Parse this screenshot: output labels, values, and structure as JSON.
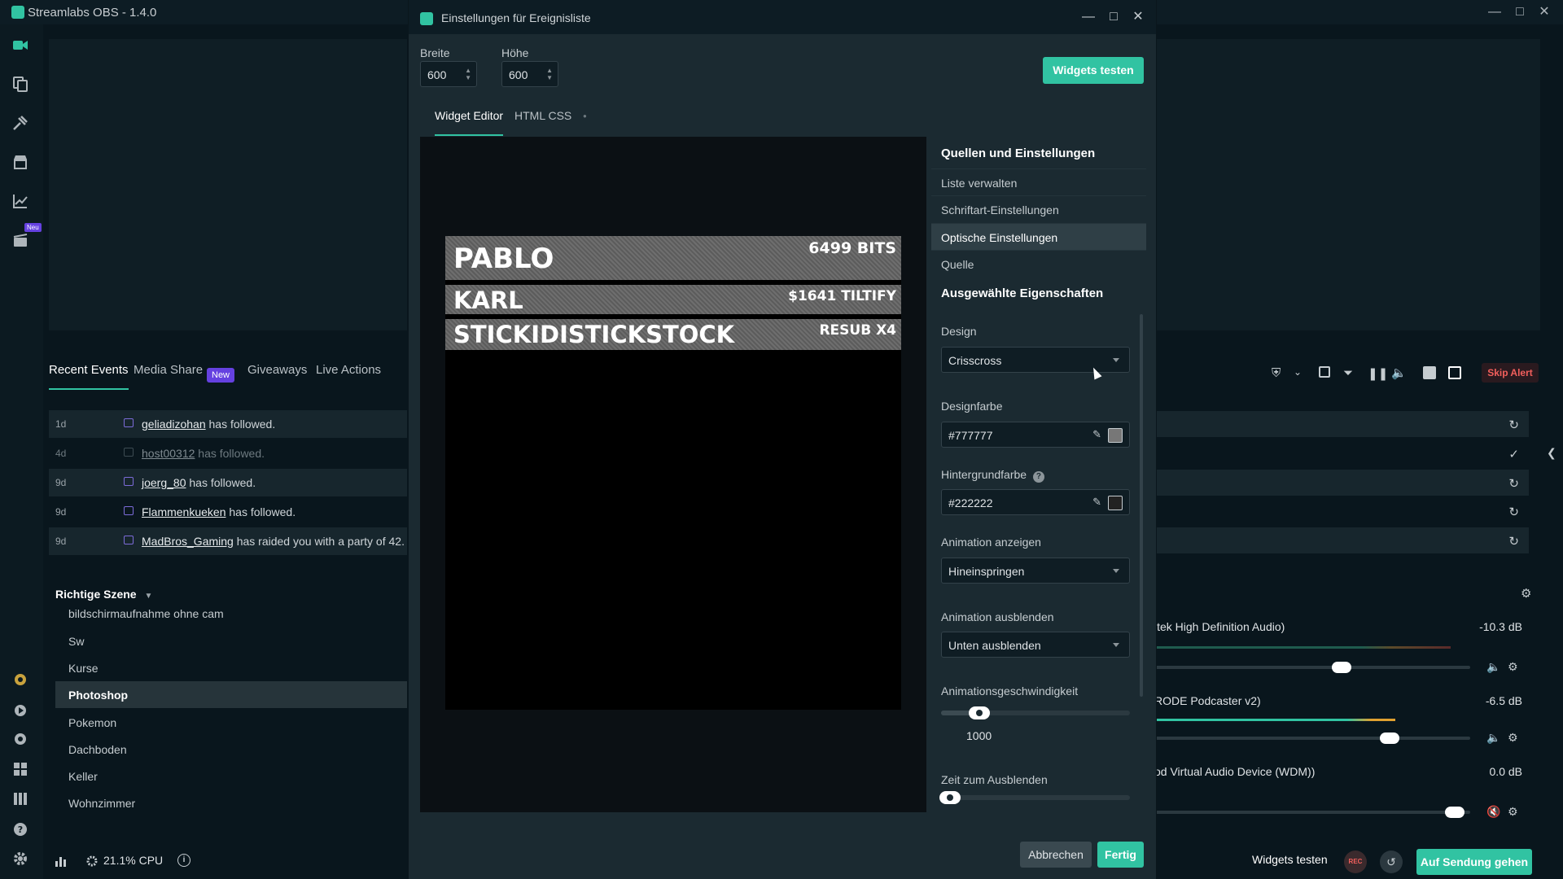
{
  "app": {
    "title": "Streamlabs OBS - 1.4.0"
  },
  "nav": {
    "new_badge": "Neu"
  },
  "events": {
    "tabs": [
      "Recent Events",
      "Media Share",
      "Giveaways",
      "Live Actions"
    ],
    "new_badge": "New",
    "rows": [
      {
        "age": "1d",
        "user": "geliadizohan",
        "text": "has followed."
      },
      {
        "age": "4d",
        "user": "host00312",
        "text": "has followed."
      },
      {
        "age": "9d",
        "user": "joerg_80",
        "text": "has followed."
      },
      {
        "age": "9d",
        "user": "Flammenkueken",
        "text": "has followed."
      },
      {
        "age": "9d",
        "user": "MadBros_Gaming",
        "text": "has raided you with a party of 42."
      }
    ]
  },
  "scenes": {
    "title": "Richtige Szene",
    "items": [
      "bildschirmaufnahme ohne cam",
      "Sw",
      "Kurse",
      "Photoshop",
      "Pokemon",
      "Dachboden",
      "Keller",
      "Wohnzimmer"
    ],
    "selected": "Photoshop"
  },
  "status": {
    "cpu": "21.1% CPU"
  },
  "right": {
    "skip_alert": "Skip Alert",
    "mixer": [
      {
        "name": "ltek High Definition Audio)",
        "db": "-10.3 dB",
        "level": 0.6
      },
      {
        "name": "RODE Podcaster v2)",
        "db": "-6.5 dB",
        "level": 0.76
      },
      {
        "name": "od Virtual Audio Device (WDM))",
        "db": "0.0 dB",
        "level": 0.98
      }
    ],
    "widgets_testen": "Widgets testen",
    "rec": "REC",
    "go_live": "Auf Sendung gehen"
  },
  "modal": {
    "title": "Einstellungen für Ereignisliste",
    "width_label": "Breite",
    "width_value": "600",
    "height_label": "Höhe",
    "height_value": "600",
    "test_button": "Widgets testen",
    "tabs": [
      "Widget Editor",
      "HTML CSS"
    ],
    "preview_events": [
      {
        "name": "PABLO",
        "value": "6499 BITS"
      },
      {
        "name": "KARL",
        "value": "$1641 TILTIFY"
      },
      {
        "name": "STICKIDISTICKSTOCK",
        "value": "RESUB X4"
      }
    ],
    "settings": {
      "sources_title": "Quellen und Einstellungen",
      "menu": [
        "Liste verwalten",
        "Schriftart-Einstellungen",
        "Optische Einstellungen",
        "Quelle"
      ],
      "menu_selected": "Optische Einstellungen",
      "props_title": "Ausgewählte Eigenschaften",
      "design_label": "Design",
      "design_value": "Crisscross",
      "design_color_label": "Designfarbe",
      "design_color": "#777777",
      "bg_color_label": "Hintergrundfarbe",
      "bg_color": "#222222",
      "anim_show_label": "Animation anzeigen",
      "anim_show_value": "Hineinspringen",
      "anim_hide_label": "Animation ausblenden",
      "anim_hide_value": "Unten ausblenden",
      "anim_speed_label": "Animationsgeschwindigkeit",
      "anim_speed_value": "1000",
      "fade_time_label": "Zeit zum Ausblenden"
    },
    "cancel": "Abbrechen",
    "done": "Fertig"
  },
  "colors": {
    "accent": "#31c3a2",
    "new_badge": "#6541e0",
    "skip": "#f25f5c"
  }
}
